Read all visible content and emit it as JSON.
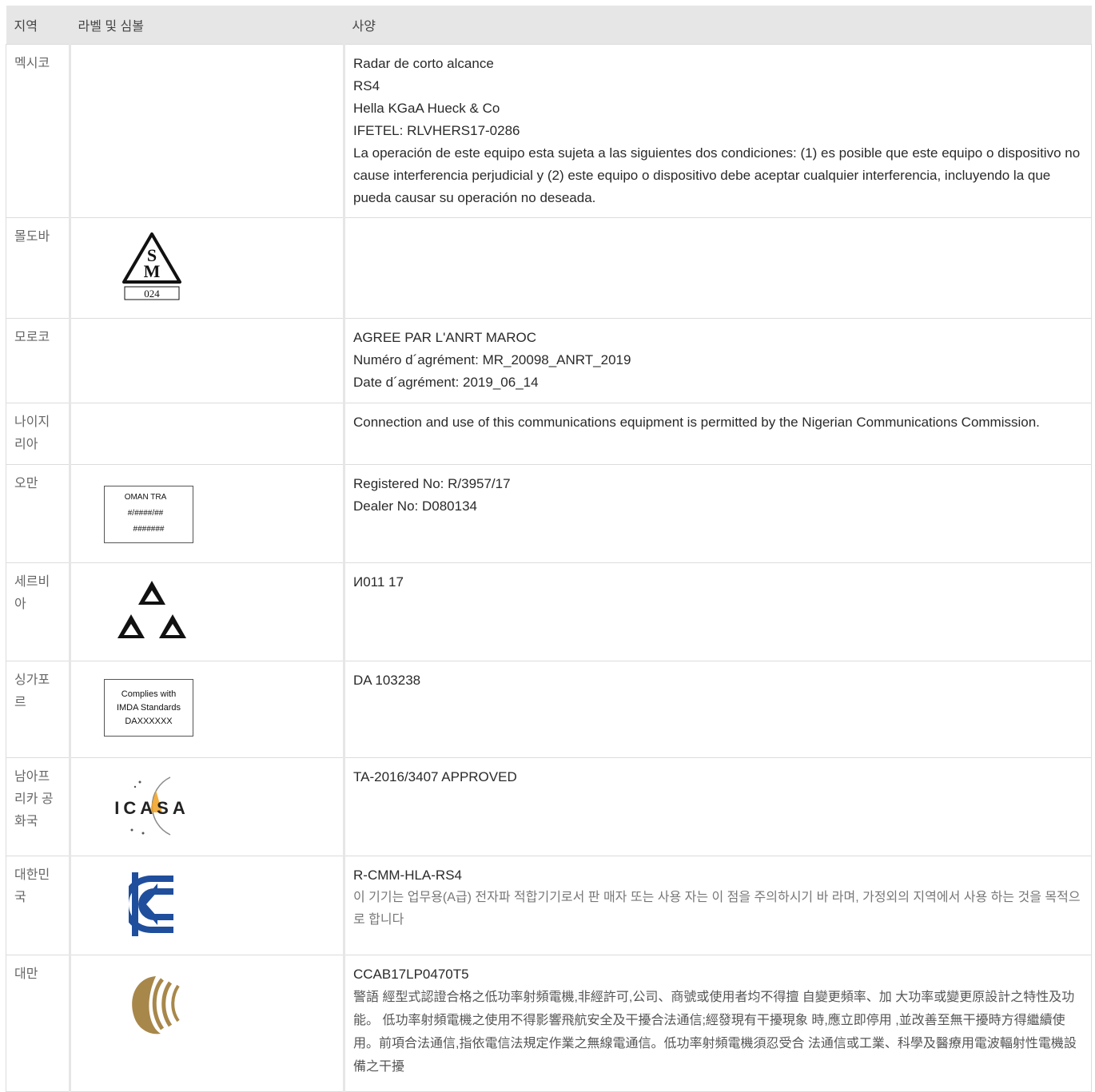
{
  "header": {
    "col_region": "지역",
    "col_label": "라벨 및 심볼",
    "col_spec": "사양"
  },
  "rows": [
    {
      "region": "멕시코",
      "spec": [
        "Radar de corto alcance",
        "RS4",
        "Hella KGaA Hueck & Co",
        "IFETEL: RLVHERS17-0286",
        "La operación de este equipo esta sujeta a las siguientes dos condiciones: (1) es posible que este equipo o dispositivo no cause interferencia perjudicial y (2) este equipo o dispositivo debe aceptar cualquier interferencia, incluyendo la que pueda causar su operación no deseada."
      ]
    },
    {
      "region": "몰도바",
      "logo": {
        "icon": "moldova-sm-icon",
        "code": "024"
      },
      "spec": []
    },
    {
      "region": "모로코",
      "spec": [
        "AGREE PAR L'ANRT MAROC",
        "Numéro d´agrément: MR_20098_ANRT_2019",
        "Date d´agrément: 2019_06_14"
      ]
    },
    {
      "region": "나이지리아",
      "spec": [
        "Connection and use of this communications equipment is permitted by the Nigerian Communications Commission."
      ]
    },
    {
      "region": "오만",
      "logo": {
        "icon": "oman-tra-label",
        "lines": [
          "OMAN TRA",
          "#/####/##",
          "#######"
        ]
      },
      "spec": [
        "Registered No: R/3957/17",
        "Dealer No: D080134"
      ]
    },
    {
      "region": "세르비아",
      "logo": {
        "icon": "serbia-triangle-icon"
      },
      "spec": [
        "И011 17"
      ]
    },
    {
      "region": "싱가포르",
      "logo": {
        "icon": "imda-label",
        "lines": [
          "Complies with",
          "IMDA Standards",
          "DAXXXXXX"
        ]
      },
      "spec": [
        "DA 103238"
      ]
    },
    {
      "region": "남아프리카 공화국",
      "logo": {
        "icon": "icasa-logo",
        "text": "ICASA"
      },
      "spec": [
        "TA-2016/3407 APPROVED"
      ]
    },
    {
      "region": "대한민국",
      "logo": {
        "icon": "kc-mark-icon"
      },
      "spec": [
        "R-CMM-HLA-RS4"
      ],
      "spec_note": "이 기기는 업무용(A급) 전자파 적합기기로서 판 매자 또는 사용 자는 이 점을 주의하시기 바 라며, 가정외의 지역에서 사용 하는 것을 목적으 로 합니다"
    },
    {
      "region": "대만",
      "logo": {
        "icon": "ncc-logo-icon"
      },
      "spec": [
        "CCAB17LP0470T5"
      ],
      "spec_note": "警語 經型式認證合格之低功率射頻電機,非經許可,公司、商號或使用者均不得擅 自變更頻率、加 大功率或變更原設計之特性及功能。 低功率射頻電機之使用不得影響飛航安全及干擾合法通信;經發現有干擾現象 時,應立即停用 ,並改善至無干擾時方得繼續使用。前項合法通信,指依電信法規定作業之無線電通信。低功率射頻電機須忍受合 法通信或工業、科學及醫療用電波輻射性電機設備之干擾"
    }
  ],
  "colors": {
    "header_bg": "#e6e6e6",
    "border": "#dcdcdc",
    "kc_blue": "#1f4e9c",
    "ncc_gold": "#a8874a",
    "icasa_orange": "#f0a020"
  }
}
